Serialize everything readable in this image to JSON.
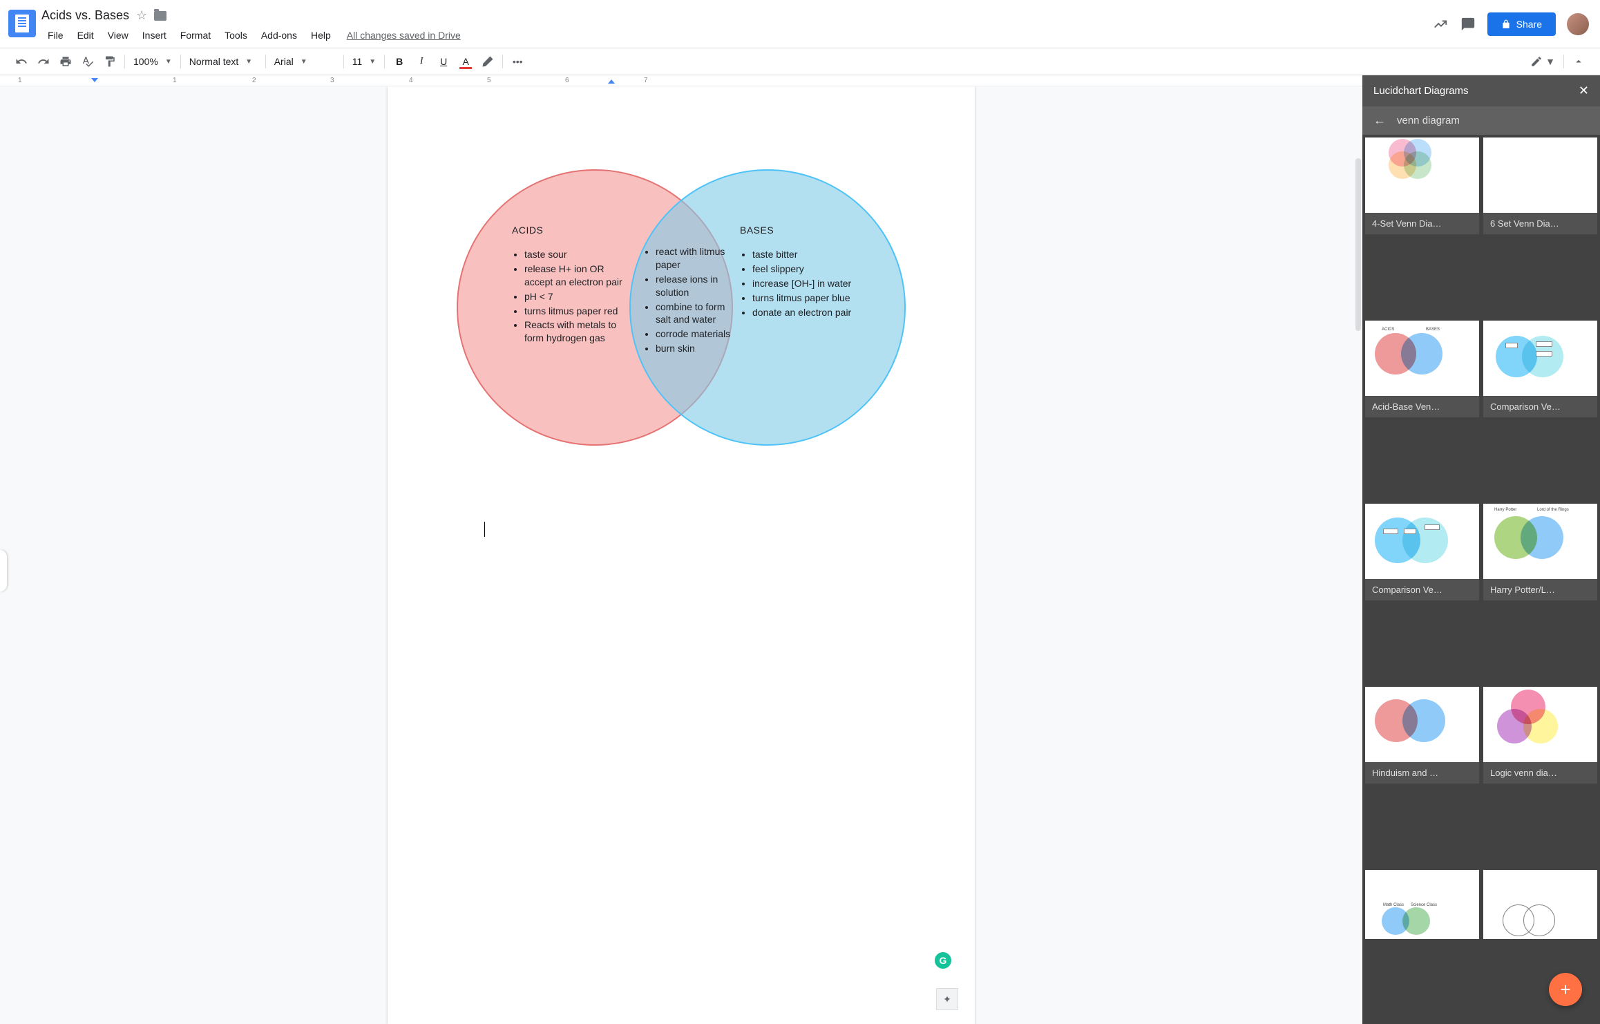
{
  "doc": {
    "title": "Acids vs. Bases",
    "saved": "All changes saved in Drive"
  },
  "menu": [
    "File",
    "Edit",
    "View",
    "Insert",
    "Format",
    "Tools",
    "Add-ons",
    "Help"
  ],
  "share": "Share",
  "toolbar": {
    "zoom": "100%",
    "style": "Normal text",
    "font": "Arial",
    "size": "11"
  },
  "ruler": [
    "1",
    "1",
    "2",
    "3",
    "4",
    "5",
    "6",
    "7"
  ],
  "venn": {
    "leftTitle": "ACIDS",
    "rightTitle": "BASES",
    "left": [
      "taste sour",
      "release H+ ion OR accept an electron pair",
      "pH < 7",
      "turns litmus paper red",
      "Reacts with metals to form hydrogen gas"
    ],
    "both": [
      "react with litmus paper",
      "release ions in solution",
      "combine to form salt and water",
      "corrode materials",
      "burn skin"
    ],
    "right": [
      "taste bitter",
      "feel slippery",
      "increase [OH-] in water",
      "turns litmus paper blue",
      "donate an electron pair"
    ]
  },
  "sidebar": {
    "title": "Lucidchart Diagrams",
    "query": "venn diagram",
    "items": [
      "4-Set Venn Dia…",
      "6 Set Venn Dia…",
      "Acid-Base Ven…",
      "Comparison Ve…",
      "Comparison Ve…",
      "Harry Potter/L…",
      "Hinduism and …",
      "Logic venn dia…"
    ],
    "fab": "+"
  },
  "grammarly": "G"
}
